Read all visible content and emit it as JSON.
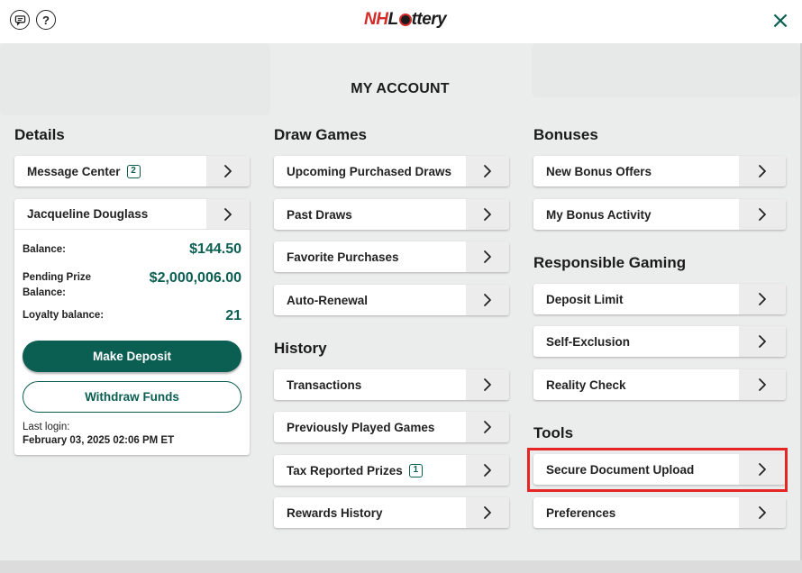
{
  "header": {
    "help_glyph": "?",
    "logo_nh": "NH",
    "logo_rest": "ttery",
    "close_glyph": "×"
  },
  "page_title": "MY ACCOUNT",
  "details": {
    "heading": "Details",
    "message_center": {
      "label": "Message Center",
      "count": "2"
    },
    "account": {
      "name": "Jacqueline Douglass",
      "balance_label": "Balance:",
      "balance_value": "$144.50",
      "pending_label_1": "Pending Prize",
      "pending_label_2": "Balance:",
      "pending_value": "$2,000,006.00",
      "loyalty_label": "Loyalty balance:",
      "loyalty_value": "21",
      "deposit_label": "Make Deposit",
      "withdraw_label": "Withdraw Funds",
      "last_login_label": "Last login:",
      "last_login_value": "February 03, 2025 02:06 PM ET"
    }
  },
  "draw_games": {
    "heading": "Draw Games",
    "items": [
      {
        "label": "Upcoming Purchased Draws"
      },
      {
        "label": "Past Draws"
      },
      {
        "label": "Favorite Purchases"
      },
      {
        "label": "Auto-Renewal"
      }
    ]
  },
  "history": {
    "heading": "History",
    "items": [
      {
        "label": "Transactions"
      },
      {
        "label": "Previously Played Games"
      },
      {
        "label": "Tax Reported Prizes",
        "count": "1"
      },
      {
        "label": "Rewards History"
      }
    ]
  },
  "bonuses": {
    "heading": "Bonuses",
    "items": [
      {
        "label": "New Bonus Offers"
      },
      {
        "label": "My Bonus Activity"
      }
    ]
  },
  "responsible_gaming": {
    "heading": "Responsible Gaming",
    "items": [
      {
        "label": "Deposit Limit"
      },
      {
        "label": "Self-Exclusion"
      },
      {
        "label": "Reality Check"
      }
    ]
  },
  "tools": {
    "heading": "Tools",
    "items": [
      {
        "label": "Secure Document Upload"
      },
      {
        "label": "Preferences"
      }
    ]
  },
  "colors": {
    "accent": "#0b5e52",
    "highlight": "#e52626",
    "logo_red": "#d42b2b"
  },
  "icons": {
    "chat": "chat-bubble-icon",
    "help": "help-circle-icon",
    "close": "close-icon",
    "chevron": "chevron-right-icon"
  }
}
